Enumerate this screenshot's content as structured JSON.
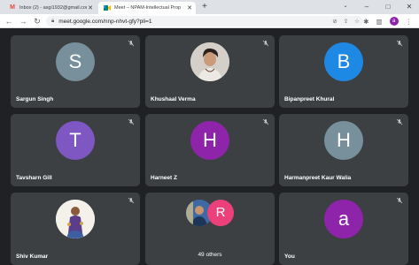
{
  "browser": {
    "tabs": [
      {
        "title": "Inbox (2) - asgi1932@gmail.com",
        "favicon": "gmail-icon",
        "active": false
      },
      {
        "title": "Meet – NPAM-Intellectual Prop",
        "favicon": "meet-icon",
        "active": true
      }
    ],
    "new_tab": "+",
    "address": {
      "url": "meet.google.com/nnp-nhvt-gfy?pli=1"
    },
    "profile_initial": "a"
  },
  "participants": [
    {
      "name": "Sargun Singh",
      "initial": "S",
      "color": "#78909c",
      "kind": "letter",
      "muted": true
    },
    {
      "name": "Khushaal Verma",
      "initial": "",
      "color": "#d9d6d2",
      "kind": "photo",
      "muted": true
    },
    {
      "name": "Bipanpreet Khural",
      "initial": "B",
      "color": "#1e88e5",
      "kind": "letter",
      "muted": true
    },
    {
      "name": "Tavsharn Gill",
      "initial": "T",
      "color": "#7e57c2",
      "kind": "letter",
      "muted": true
    },
    {
      "name": "Harneet Z",
      "initial": "H",
      "color": "#8e24aa",
      "kind": "letter",
      "muted": true
    },
    {
      "name": "Harmanpreet Kaur Walia",
      "initial": "H",
      "color": "#78909c",
      "kind": "letter",
      "muted": true
    },
    {
      "name": "Shiv Kumar",
      "initial": "",
      "color": "#ffffff",
      "kind": "photo",
      "muted": true
    },
    {
      "name": "You",
      "initial": "a",
      "color": "#8e24aa",
      "kind": "letter",
      "muted": true
    }
  ],
  "others": {
    "label": "49 others",
    "avatar_initial": "R",
    "avatar_color": "#ec407a"
  }
}
